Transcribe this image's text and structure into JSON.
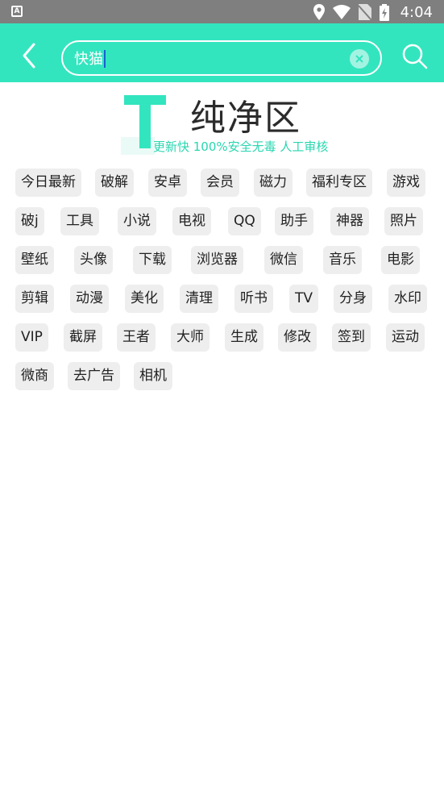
{
  "statusbar": {
    "time": "4:04",
    "app_icon_letter": "A"
  },
  "search": {
    "value": "快猫",
    "placeholder": ""
  },
  "banner": {
    "logo_letter": "T",
    "title": "纯净区",
    "slogan": "更新快 100%安全无毒 人工审核"
  },
  "tags": [
    [
      "今日最新",
      "破解",
      "安卓",
      "会员",
      "磁力",
      "福利专区",
      "游戏"
    ],
    [
      "破j",
      "工具",
      "小说",
      "电视",
      "QQ",
      "助手",
      "神器",
      "照片"
    ],
    [
      "壁纸",
      "头像",
      "下载",
      "浏览器",
      "微信",
      "音乐",
      "电影"
    ],
    [
      "剪辑",
      "动漫",
      "美化",
      "清理",
      "听书",
      "TV",
      "分身",
      "水印"
    ],
    [
      "VIP",
      "截屏",
      "王者",
      "大师",
      "生成",
      "修改",
      "签到",
      "运动"
    ],
    [
      "微商",
      "去广告",
      "相机"
    ]
  ],
  "colors": {
    "accent": "#33e5bf",
    "tag_bg": "#eeeeee",
    "status_bar": "#7f7f7f"
  }
}
